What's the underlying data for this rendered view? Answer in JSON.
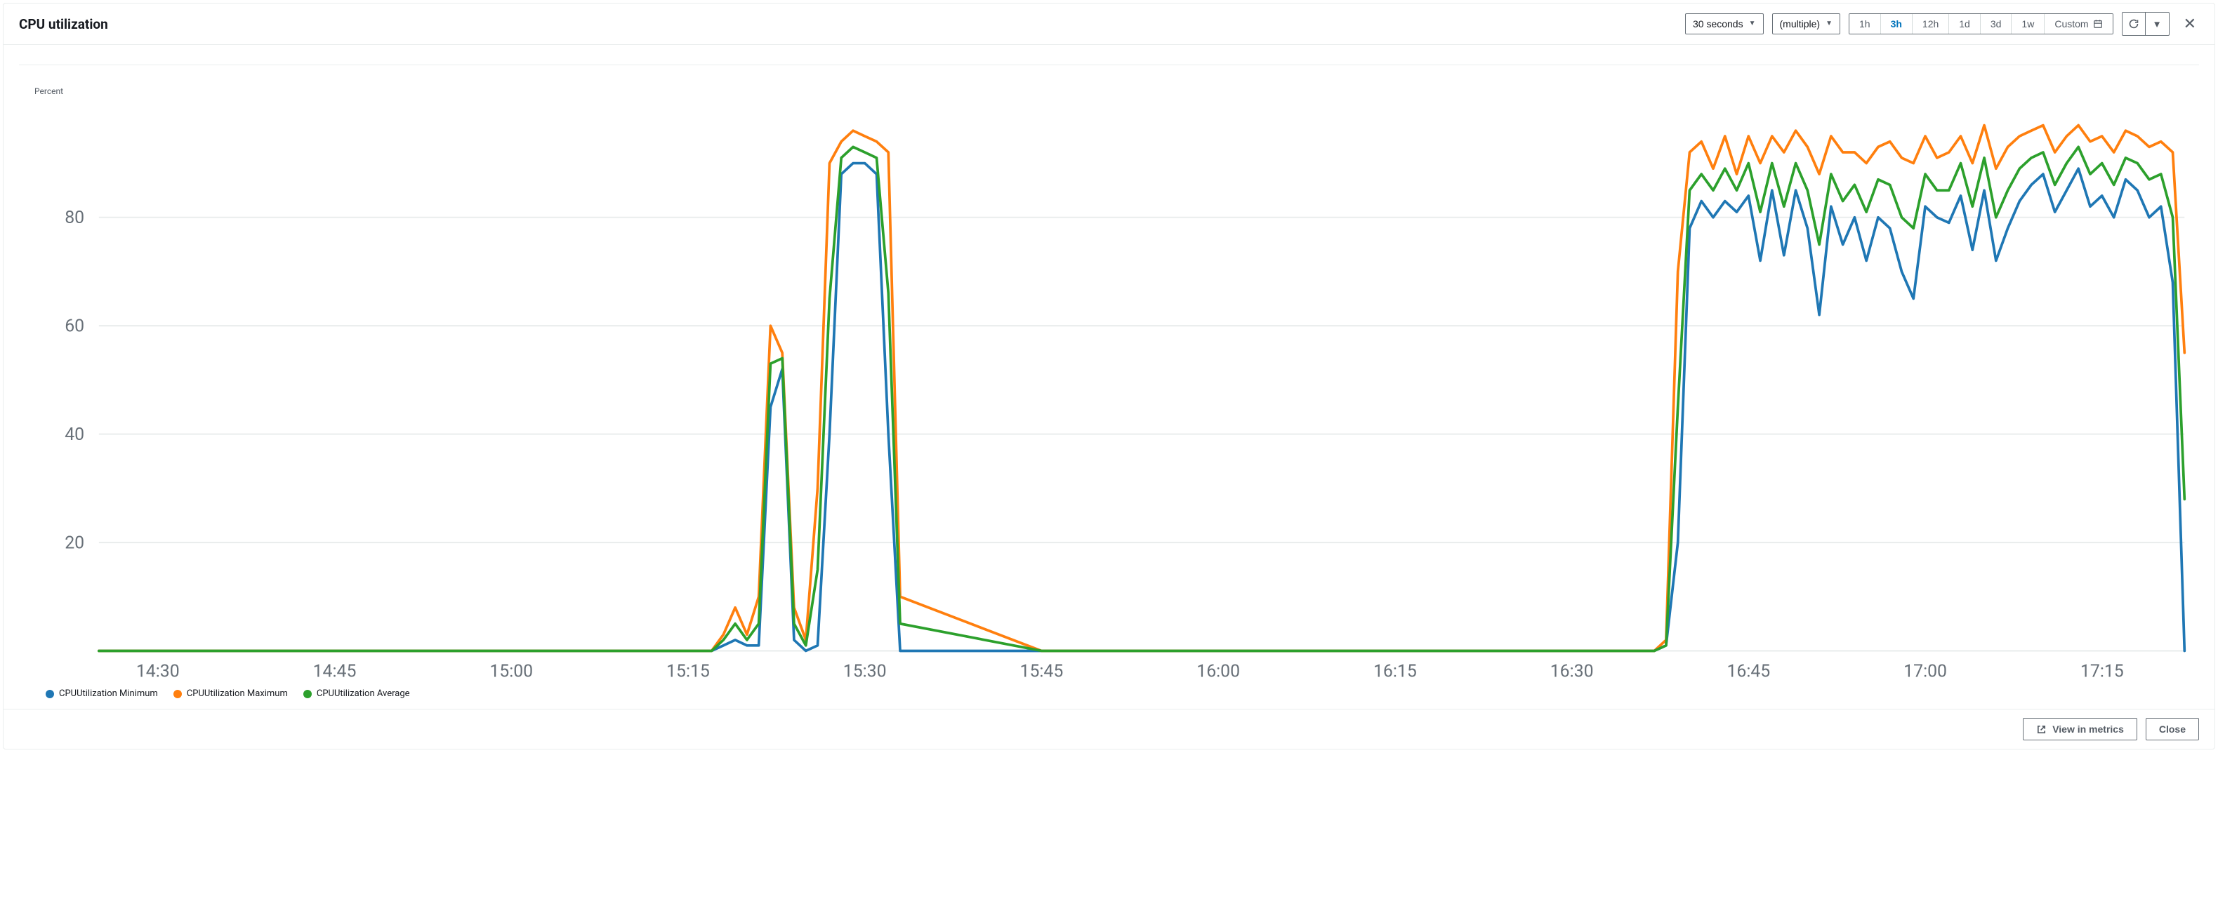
{
  "title": "CPU utilization",
  "toolbar": {
    "period_label": "30 seconds",
    "stat_label": "(multiple)",
    "ranges": [
      "1h",
      "3h",
      "12h",
      "1d",
      "3d",
      "1w"
    ],
    "active_range": "3h",
    "custom_label": "Custom"
  },
  "chart": {
    "ylabel": "Percent"
  },
  "legend": [
    {
      "name": "CPUUtilization Minimum",
      "color": "#1f77b4"
    },
    {
      "name": "CPUUtilization Maximum",
      "color": "#ff7f0e"
    },
    {
      "name": "CPUUtilization Average",
      "color": "#2ca02c"
    }
  ],
  "footer": {
    "view_label": "View in metrics",
    "close_label": "Close"
  },
  "chart_data": {
    "type": "line",
    "title": "CPU utilization",
    "xlabel": "",
    "ylabel": "Percent",
    "ylim": [
      0,
      100
    ],
    "x": [
      "14:25",
      "14:30",
      "14:45",
      "15:00",
      "15:15",
      "15:17",
      "15:18",
      "15:19",
      "15:20",
      "15:21",
      "15:22",
      "15:23",
      "15:24",
      "15:25",
      "15:26",
      "15:27",
      "15:28",
      "15:29",
      "15:30",
      "15:31",
      "15:32",
      "15:33",
      "15:45",
      "16:00",
      "16:15",
      "16:30",
      "16:37",
      "16:38",
      "16:39",
      "16:40",
      "16:41",
      "16:42",
      "16:43",
      "16:44",
      "16:45",
      "16:46",
      "16:47",
      "16:48",
      "16:49",
      "16:50",
      "16:51",
      "16:52",
      "16:53",
      "16:54",
      "16:55",
      "16:56",
      "16:57",
      "16:58",
      "16:59",
      "17:00",
      "17:01",
      "17:02",
      "17:03",
      "17:04",
      "17:05",
      "17:06",
      "17:07",
      "17:08",
      "17:09",
      "17:10",
      "17:11",
      "17:12",
      "17:13",
      "17:14",
      "17:15",
      "17:16",
      "17:17",
      "17:18",
      "17:19",
      "17:20",
      "17:21",
      "17:22"
    ],
    "x_ticks": [
      "14:30",
      "14:45",
      "15:00",
      "15:15",
      "15:30",
      "15:45",
      "16:00",
      "16:15",
      "16:30",
      "16:45",
      "17:00",
      "17:15"
    ],
    "y_ticks": [
      20,
      40,
      60,
      80
    ],
    "series": [
      {
        "name": "CPUUtilization Minimum",
        "color": "#1f77b4",
        "values": [
          0,
          0,
          0,
          0,
          0,
          0,
          1,
          2,
          1,
          1,
          45,
          52,
          2,
          0,
          1,
          40,
          88,
          90,
          90,
          88,
          40,
          0,
          0,
          0,
          0,
          0,
          0,
          1,
          20,
          78,
          83,
          80,
          83,
          81,
          84,
          72,
          85,
          73,
          85,
          78,
          62,
          82,
          75,
          80,
          72,
          80,
          78,
          70,
          65,
          82,
          80,
          79,
          84,
          74,
          85,
          72,
          78,
          83,
          86,
          88,
          81,
          85,
          89,
          82,
          84,
          80,
          87,
          85,
          80,
          82,
          68,
          0
        ]
      },
      {
        "name": "CPUUtilization Maximum",
        "color": "#ff7f0e",
        "values": [
          0,
          0,
          0,
          0,
          0,
          0,
          3,
          8,
          3,
          10,
          60,
          55,
          8,
          2,
          30,
          90,
          94,
          96,
          95,
          94,
          92,
          10,
          0,
          0,
          0,
          0,
          0,
          2,
          70,
          92,
          94,
          89,
          95,
          88,
          95,
          90,
          95,
          92,
          96,
          93,
          88,
          95,
          92,
          92,
          90,
          93,
          94,
          91,
          90,
          95,
          91,
          92,
          95,
          90,
          97,
          89,
          93,
          95,
          96,
          97,
          92,
          95,
          97,
          94,
          95,
          92,
          96,
          95,
          93,
          94,
          92,
          55
        ]
      },
      {
        "name": "CPUUtilization Average",
        "color": "#2ca02c",
        "values": [
          0,
          0,
          0,
          0,
          0,
          0,
          2,
          5,
          2,
          5,
          53,
          54,
          5,
          1,
          15,
          65,
          91,
          93,
          92,
          91,
          66,
          5,
          0,
          0,
          0,
          0,
          0,
          1,
          45,
          85,
          88,
          85,
          89,
          85,
          90,
          81,
          90,
          82,
          90,
          85,
          75,
          88,
          83,
          86,
          81,
          87,
          86,
          80,
          78,
          88,
          85,
          85,
          90,
          82,
          91,
          80,
          85,
          89,
          91,
          92,
          86,
          90,
          93,
          88,
          90,
          86,
          91,
          90,
          87,
          88,
          80,
          28
        ]
      }
    ]
  }
}
